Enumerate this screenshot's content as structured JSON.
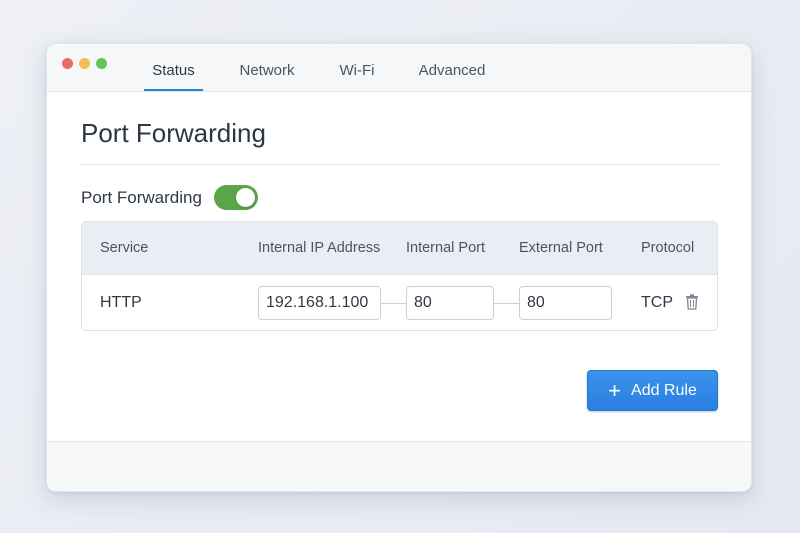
{
  "window": {
    "tabs": [
      {
        "label": "Status",
        "active": true
      },
      {
        "label": "Network",
        "active": false
      },
      {
        "label": "Wi-Fi",
        "active": false
      },
      {
        "label": "Advanced",
        "active": false
      }
    ]
  },
  "page": {
    "title": "Port Forwarding",
    "toggle_label": "Port Forwarding",
    "toggle_on": true
  },
  "table": {
    "headers": [
      "Service",
      "Internal IP Address",
      "Internal Port",
      "External Port",
      "Protocol"
    ],
    "rows": [
      {
        "service": "HTTP",
        "internal_ip": "192.168.1.100",
        "internal_port": "80",
        "external_port": "80",
        "protocol": "TCP",
        "delete_icon": "trash-icon"
      }
    ]
  },
  "actions": {
    "add_rule_label": "Add Rule",
    "add_icon": "plus-icon"
  },
  "colors": {
    "accent": "#2b82e0",
    "toggle_on": "#5aa54a",
    "header_bg": "#e9edf4"
  }
}
